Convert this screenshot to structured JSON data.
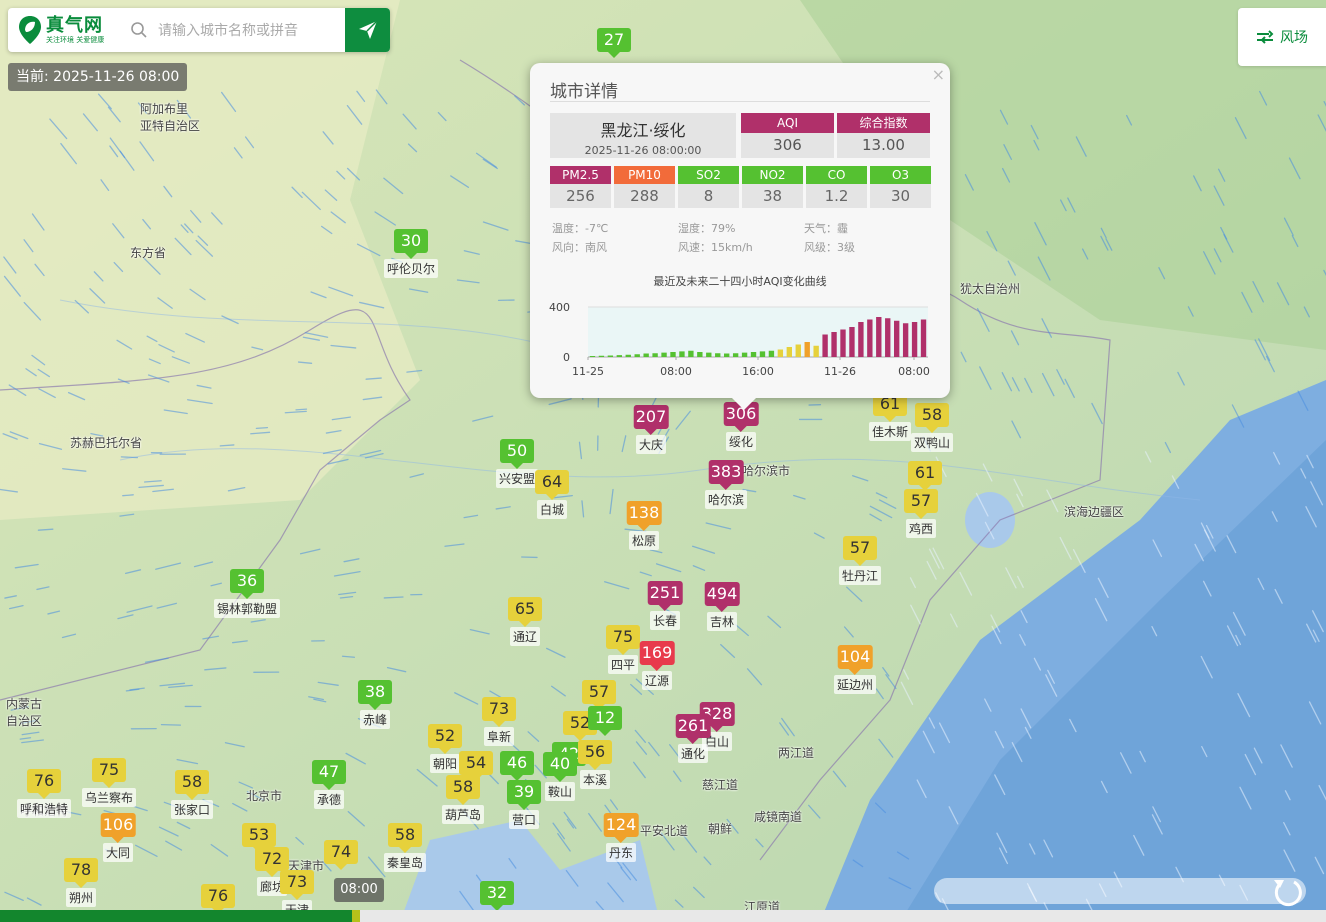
{
  "app": {
    "logo_title": "真气网",
    "logo_sub": "关注环境 关爱健康",
    "search_placeholder": "请输入城市名称或拼音",
    "current_time": "当前: 2025-11-26 08:00",
    "wind_label": "风场",
    "timeline_time": "08:00"
  },
  "colors": {
    "good": "#55c131",
    "moderate": "#e6d13b",
    "usg": "#f0a12a",
    "unhealthy": "#e83a4c",
    "very_unhealthy": "#b0306a",
    "hazardous": "#8a2047",
    "brand": "#0e8d3f"
  },
  "popup": {
    "title": "城市详情",
    "city": "黑龙江·绥化",
    "time": "2025-11-26 08:00:00",
    "aqi_label": "AQI",
    "aqi_value": "306",
    "composite_label": "综合指数",
    "composite_value": "13.00",
    "pollutants": [
      {
        "name": "PM2.5",
        "value": "256",
        "color": "#b0306a"
      },
      {
        "name": "PM10",
        "value": "288",
        "color": "#f26b3a"
      },
      {
        "name": "SO2",
        "value": "8",
        "color": "#55c131"
      },
      {
        "name": "NO2",
        "value": "38",
        "color": "#55c131"
      },
      {
        "name": "CO",
        "value": "1.2",
        "color": "#55c131"
      },
      {
        "name": "O3",
        "value": "30",
        "color": "#55c131"
      }
    ],
    "weather": {
      "temp": "温度：-7℃",
      "humidity": "湿度：79%",
      "cond": "天气：霾",
      "wind_dir": "风向：南风",
      "wind_speed": "风速：15km/h",
      "wind_level": "风级：3级"
    },
    "chart_title": "最近及未来二十四小时AQI变化曲线"
  },
  "chart_data": {
    "type": "bar",
    "ylim": [
      0,
      400
    ],
    "yticks": [
      "0",
      "400"
    ],
    "xticks": [
      "11-25",
      "08:00",
      "16:00",
      "11-26",
      "08:00"
    ],
    "values": [
      8,
      10,
      12,
      15,
      18,
      22,
      28,
      30,
      35,
      40,
      45,
      50,
      40,
      35,
      30,
      28,
      30,
      35,
      40,
      45,
      50,
      60,
      80,
      100,
      120,
      90,
      180,
      200,
      220,
      240,
      280,
      300,
      320,
      310,
      290,
      270,
      280,
      300
    ]
  },
  "places": [
    {
      "name": "阿加布里\n亚特自治区"
    },
    {
      "name": "东方省"
    },
    {
      "name": "苏赫巴托尔省"
    },
    {
      "name": "内蒙古\n自治区"
    },
    {
      "name": "犹太自治州"
    },
    {
      "name": "滨海边疆区"
    },
    {
      "name": "哈尔滨市"
    },
    {
      "name": "两江道"
    },
    {
      "name": "慈江道"
    },
    {
      "name": "咸镜南道"
    },
    {
      "name": "平安北道"
    },
    {
      "name": "朝鲜"
    },
    {
      "name": "江原道"
    },
    {
      "name": "北京市"
    },
    {
      "name": "天津市"
    },
    {
      "name": "呼和浩特"
    }
  ],
  "stations": [
    {
      "aqi": "27",
      "name": ""
    },
    {
      "aqi": "30",
      "name": "呼伦贝尔"
    },
    {
      "aqi": "207",
      "name": "大庆"
    },
    {
      "aqi": "306",
      "name": "绥化"
    },
    {
      "aqi": "61",
      "name": "佳木斯"
    },
    {
      "aqi": "58",
      "name": "双鸭山"
    },
    {
      "aqi": "50",
      "name": "兴安盟"
    },
    {
      "aqi": "64",
      "name": "白城"
    },
    {
      "aqi": "383",
      "name": "哈尔滨"
    },
    {
      "aqi": "61",
      "name": ""
    },
    {
      "aqi": "57",
      "name": "鸡西"
    },
    {
      "aqi": "138",
      "name": "松原"
    },
    {
      "aqi": "57",
      "name": "牡丹江"
    },
    {
      "aqi": "36",
      "name": "锡林郭勒盟"
    },
    {
      "aqi": "251",
      "name": "长春"
    },
    {
      "aqi": "494",
      "name": "吉林"
    },
    {
      "aqi": "65",
      "name": "通辽"
    },
    {
      "aqi": "75",
      "name": "四平"
    },
    {
      "aqi": "169",
      "name": "辽源"
    },
    {
      "aqi": "104",
      "name": "延边州"
    },
    {
      "aqi": "38",
      "name": "赤峰"
    },
    {
      "aqi": "73",
      "name": "阜新"
    },
    {
      "aqi": "57",
      "name": ""
    },
    {
      "aqi": "52",
      "name": ""
    },
    {
      "aqi": "12",
      "name": ""
    },
    {
      "aqi": "328",
      "name": "白山"
    },
    {
      "aqi": "261",
      "name": "通化"
    },
    {
      "aqi": "52",
      "name": "朝阳"
    },
    {
      "aqi": "54",
      "name": ""
    },
    {
      "aqi": "46",
      "name": ""
    },
    {
      "aqi": "42",
      "name": ""
    },
    {
      "aqi": "56",
      "name": "本溪"
    },
    {
      "aqi": "40",
      "name": "鞍山"
    },
    {
      "aqi": "58",
      "name": "葫芦岛"
    },
    {
      "aqi": "39",
      "name": "营口"
    },
    {
      "aqi": "75",
      "name": "乌兰察布"
    },
    {
      "aqi": "76",
      "name": "呼和浩特"
    },
    {
      "aqi": "58",
      "name": "张家口"
    },
    {
      "aqi": "47",
      "name": "承德"
    },
    {
      "aqi": "106",
      "name": "大同"
    },
    {
      "aqi": "53",
      "name": ""
    },
    {
      "aqi": "72",
      "name": "廊坊"
    },
    {
      "aqi": "74",
      "name": ""
    },
    {
      "aqi": "58",
      "name": "秦皇岛"
    },
    {
      "aqi": "124",
      "name": "丹东"
    },
    {
      "aqi": "78",
      "name": "朔州"
    },
    {
      "aqi": "73",
      "name": "天津"
    },
    {
      "aqi": "76",
      "name": ""
    },
    {
      "aqi": "32",
      "name": ""
    }
  ]
}
